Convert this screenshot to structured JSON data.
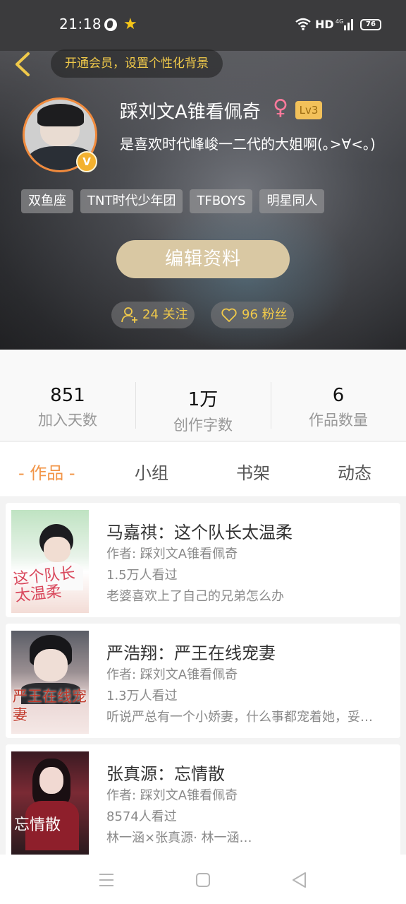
{
  "status_bar": {
    "time": "21:18",
    "network": "HD",
    "signal": "4G",
    "battery": "76"
  },
  "header": {
    "member_banner": "开通会员，设置个性化背景",
    "username": "踩刘文A锥看佩奇",
    "gender_symbol": "♀",
    "level": "Lv3",
    "vip_mark": "V",
    "bio": "是喜欢时代峰峻一二代的大姐啊(｡>∀<｡)",
    "tags": [
      "双鱼座",
      "TNT时代少年团",
      "TFBOYS",
      "明星同人"
    ],
    "edit_button": "编辑资料",
    "following": "24 关注",
    "followers": "96 粉丝"
  },
  "stats": [
    {
      "value": "851",
      "label": "加入天数"
    },
    {
      "value": "1万",
      "label": "创作字数"
    },
    {
      "value": "6",
      "label": "作品数量"
    }
  ],
  "tabs": [
    {
      "label": "- 作品 -",
      "active": true
    },
    {
      "label": "小组",
      "active": false
    },
    {
      "label": "书架",
      "active": false
    },
    {
      "label": "动态",
      "active": false
    }
  ],
  "books": [
    {
      "title": "马嘉祺：这个队长太温柔",
      "author": "作者: 踩刘文A锥看佩奇",
      "views": "1.5万人看过",
      "desc": "老婆喜欢上了自己的兄弟怎么办",
      "cover_text": "这个队长太温柔"
    },
    {
      "title": "严浩翔：严王在线宠妻",
      "author": "作者: 踩刘文A锥看佩奇",
      "views": "1.3万人看过",
      "desc": "听说严总有一个小娇妻，什么事都宠着她，妥…",
      "cover_text": "严王在线宠妻"
    },
    {
      "title": "张真源：忘情散",
      "author": "作者: 踩刘文A锥看佩奇",
      "views": "8574人看过",
      "desc": "林一涵×张真源· 林一涵…",
      "cover_text": "忘情散"
    }
  ],
  "colors": {
    "accent": "#f29446",
    "gold": "#f0c94a",
    "edit_button": "#d9c8a3"
  }
}
